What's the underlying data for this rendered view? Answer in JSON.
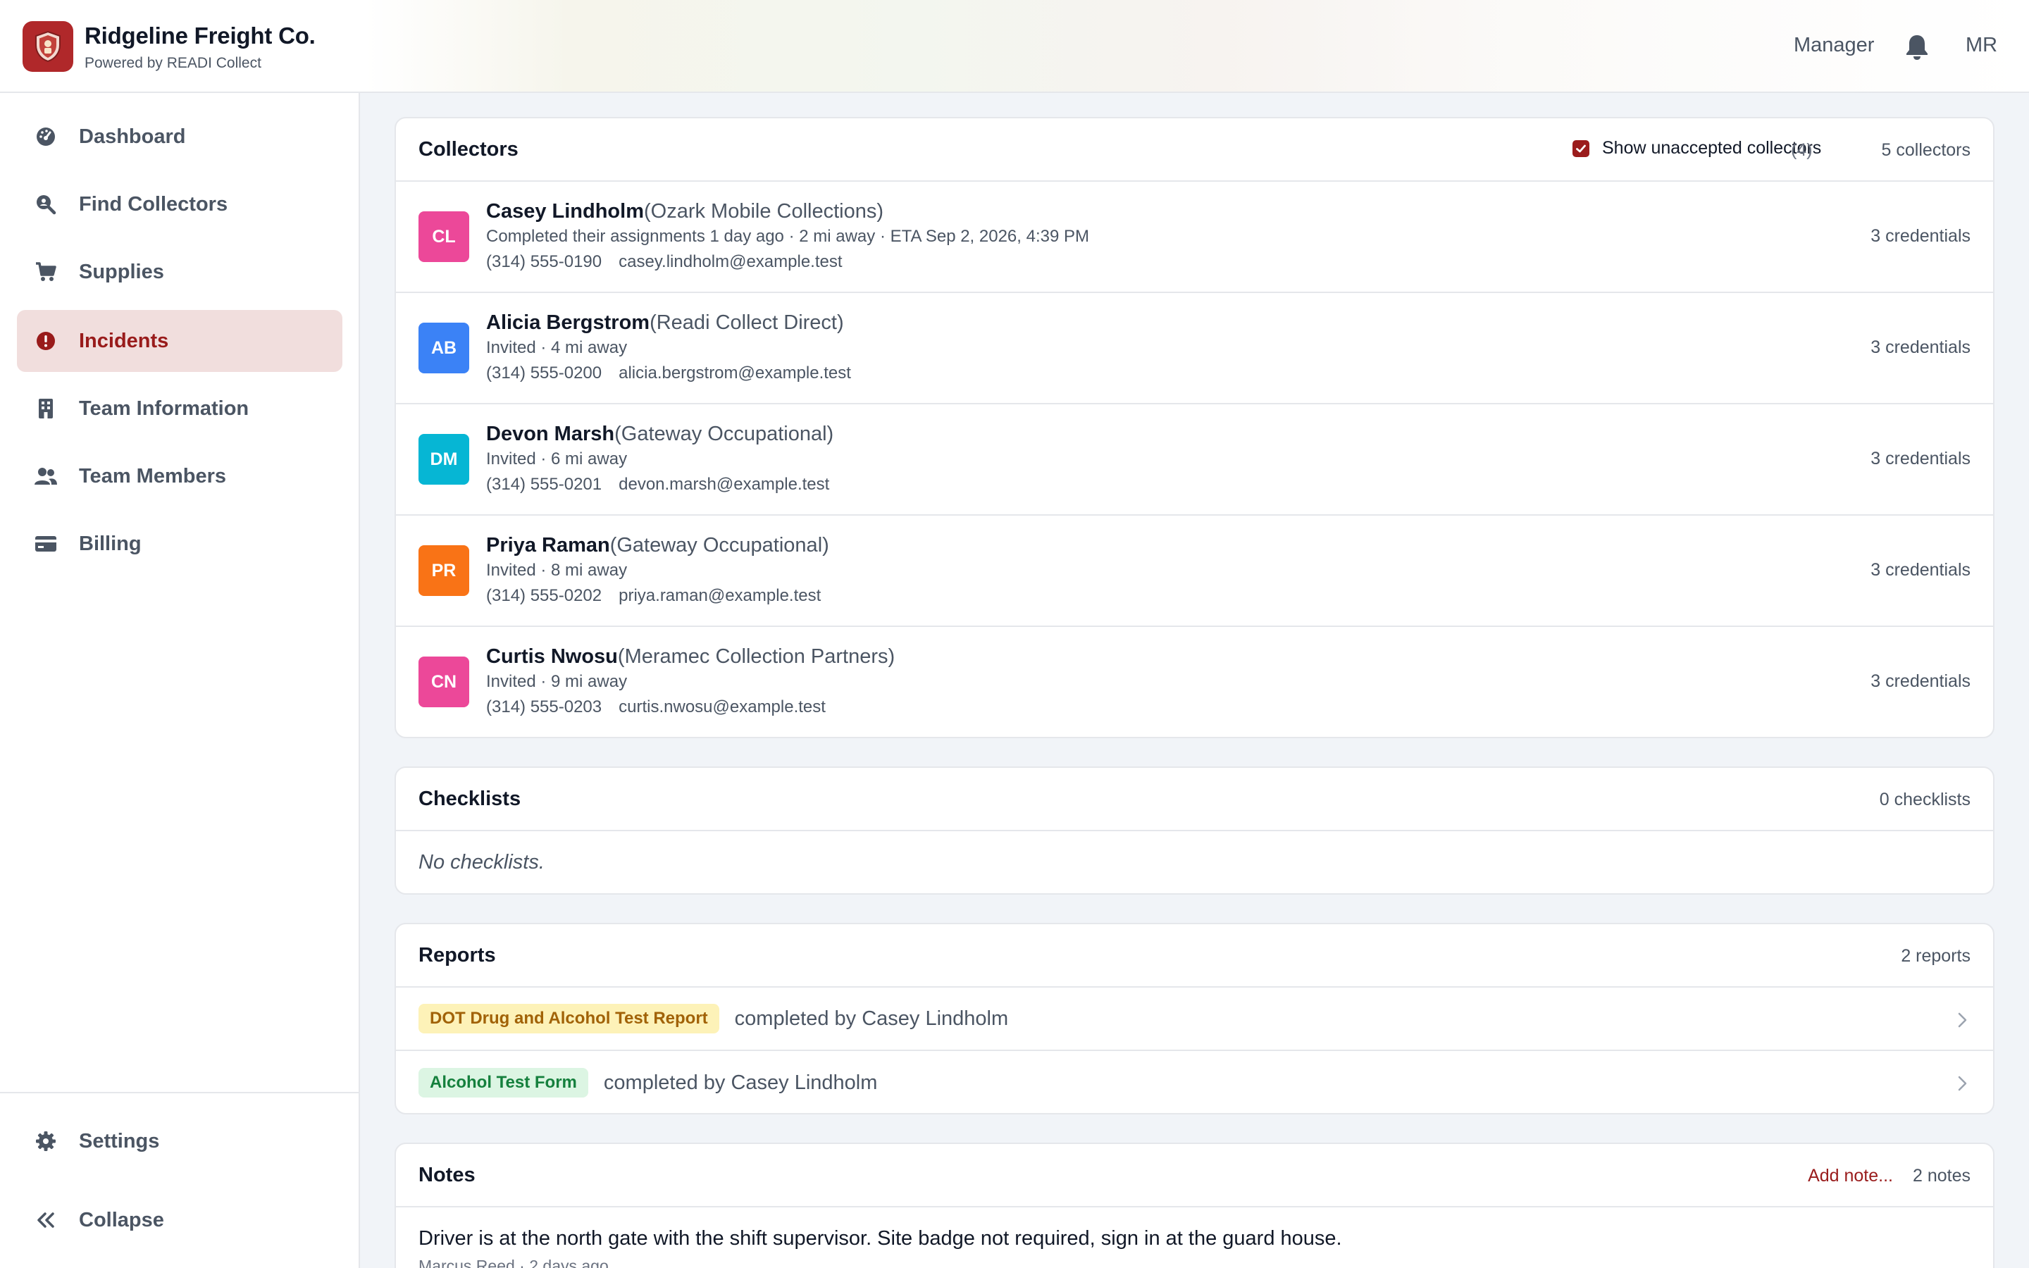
{
  "header": {
    "brand_name": "Ridgeline Freight Co.",
    "brand_sub": "Powered by READI Collect",
    "role": "Manager",
    "user_initials": "MR",
    "brand_color": "#b0282a"
  },
  "sidebar": {
    "items": [
      {
        "label": "Dashboard",
        "icon": "dashboard-gauge-icon",
        "active": false
      },
      {
        "label": "Find Collectors",
        "icon": "search-person-icon",
        "active": false
      },
      {
        "label": "Supplies",
        "icon": "cart-icon",
        "active": false
      },
      {
        "label": "Incidents",
        "icon": "alert-circle-icon",
        "active": true
      },
      {
        "label": "Team Information",
        "icon": "building-icon",
        "active": false
      },
      {
        "label": "Team Members",
        "icon": "users-icon",
        "active": false
      },
      {
        "label": "Billing",
        "icon": "credit-card-icon",
        "active": false
      }
    ],
    "settings_label": "Settings",
    "collapse_label": "Collapse"
  },
  "collectors": {
    "title": "Collectors",
    "show_unaccepted_label": "Show unaccepted collectors",
    "show_unaccepted_checked": true,
    "unaccepted_count": "(4)",
    "count_label": "5 collectors",
    "rows": [
      {
        "initials": "CL",
        "avatar_color": "#ec4899",
        "name": "Casey Lindholm",
        "org": "(Ozark Mobile Collections)",
        "status": "Completed their assignments 1 day ago · 2 mi away · ETA Sep 2, 2026, 4:39 PM",
        "phone": "(314) 555-0190",
        "email": "casey.lindholm@example.test",
        "credentials": "3 credentials"
      },
      {
        "initials": "AB",
        "avatar_color": "#3b82f6",
        "name": "Alicia Bergstrom",
        "org": "(Readi Collect Direct)",
        "status": "Invited · 4 mi away",
        "phone": "(314) 555-0200",
        "email": "alicia.bergstrom@example.test",
        "credentials": "3 credentials"
      },
      {
        "initials": "DM",
        "avatar_color": "#06b6d4",
        "name": "Devon Marsh",
        "org": "(Gateway Occupational)",
        "status": "Invited · 6 mi away",
        "phone": "(314) 555-0201",
        "email": "devon.marsh@example.test",
        "credentials": "3 credentials"
      },
      {
        "initials": "PR",
        "avatar_color": "#f97316",
        "name": "Priya Raman",
        "org": "(Gateway Occupational)",
        "status": "Invited · 8 mi away",
        "phone": "(314) 555-0202",
        "email": "priya.raman@example.test",
        "credentials": "3 credentials"
      },
      {
        "initials": "CN",
        "avatar_color": "#ec4899",
        "name": "Curtis Nwosu",
        "org": "(Meramec Collection Partners)",
        "status": "Invited · 9 mi away",
        "phone": "(314) 555-0203",
        "email": "curtis.nwosu@example.test",
        "credentials": "3 credentials"
      }
    ]
  },
  "checklists": {
    "title": "Checklists",
    "count_label": "0 checklists",
    "empty_text": "No checklists."
  },
  "reports": {
    "title": "Reports",
    "count_label": "2 reports",
    "rows": [
      {
        "badge": "DOT Drug and Alcohol Test Report",
        "badge_color": "yellow",
        "completed_by": "completed by Casey Lindholm"
      },
      {
        "badge": "Alcohol Test Form",
        "badge_color": "green",
        "completed_by": "completed by Casey Lindholm"
      }
    ]
  },
  "notes": {
    "title": "Notes",
    "add_label": "Add note...",
    "count_label": "2 notes",
    "first_note": {
      "text": "Driver is at the north gate with the shift supervisor. Site badge not required, sign in at the guard house.",
      "meta": "Marcus Reed · 2 days ago"
    }
  }
}
